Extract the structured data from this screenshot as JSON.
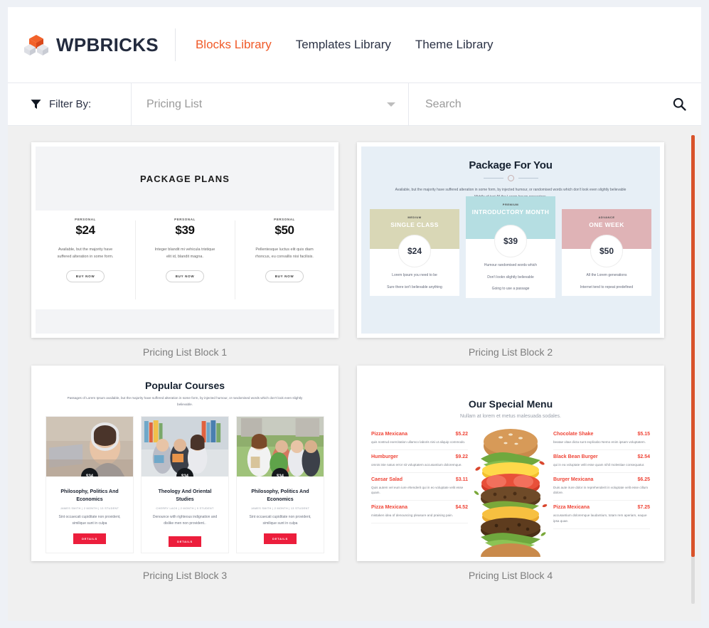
{
  "header": {
    "brand_name": "WPBRICKS",
    "logo_icon": "isometric-blocks-icon",
    "nav": [
      {
        "label": "Blocks Library",
        "active": true
      },
      {
        "label": "Templates Library",
        "active": false
      },
      {
        "label": "Theme Library",
        "active": false
      }
    ],
    "accent_color": "#f05a28"
  },
  "filterbar": {
    "funnel_icon": "funnel-icon",
    "filter_label": "Filter By:",
    "category_value": "Pricing List",
    "caret_icon": "chevron-down-icon",
    "search_value": "",
    "search_placeholder": "Search",
    "search_icon": "search-icon"
  },
  "scrollbar": {
    "thumb_color": "#d9532a",
    "track_color": "#dcdcdc"
  },
  "blocks": [
    {
      "caption": "Pricing List Block 1",
      "preview": {
        "title": "PACKAGE PLANS",
        "plans": [
          {
            "tier": "PERSONAL",
            "price": "$24",
            "desc": "Available, but the majority have suffered alteration in some form.",
            "button": "BUY NOW"
          },
          {
            "tier": "PERSONAL",
            "price": "$39",
            "desc": "Integer blandit mi vehicula tristique elit id, blandit magna.",
            "button": "BUY NOW"
          },
          {
            "tier": "PERSONAL",
            "price": "$50",
            "desc": "Pellentesque luctus elit quis diam rhoncus, eu convallis nisi facilisis.",
            "button": "BUY NOW"
          }
        ]
      }
    },
    {
      "caption": "Pricing List Block 2",
      "preview": {
        "title": "Package For You",
        "subtitle": "Available, but the majority have suffered alteration in some form, by injected humour, or randomised words which don't look even slightly believable Middle of text All the Lorem Ipsum generators.",
        "plans": [
          {
            "tier": "MEDIUM",
            "name": "SINGLE CLASS",
            "price": "$24",
            "band_color": "#d9d7b6",
            "features": [
              "Lorem Ipsum you need to be",
              "Sure there isn't believable anything"
            ]
          },
          {
            "tier": "PREMIUM",
            "name": "INTRODUCTORY MONTH",
            "price": "$39",
            "band_color": "#b5dee2",
            "features": [
              "Humour randomised words which",
              "Don't lookn slightly believable",
              "Going to use a passage"
            ]
          },
          {
            "tier": "ADVANCE",
            "name": "ONE WEEK",
            "price": "$50",
            "band_color": "#dfb3b6",
            "features": [
              "All the Lorem generations",
              "Internet tend to repeat predefined"
            ]
          }
        ]
      }
    },
    {
      "caption": "Pricing List Block 3",
      "preview": {
        "title": "Popular Courses",
        "subtitle": "Passages of Lorem Ipsum available, but the majority have suffered alteration in some form, by injected humour, or randomised words which don't look even slightly believable.",
        "courses": [
          {
            "badge": "$34",
            "name": "Philosophy, Politics And Economics",
            "meta": "JAMES SMITH | 2 MONTH | 13 STUDENT",
            "desc": "Sint occaecati cupiditate non provident, similique sunt in culpa",
            "button": "DETAILS"
          },
          {
            "badge": "$34",
            "name": "Theology And Oriental Studies",
            "meta": "CHERRY LACK | 2 MONTH | 9 STUDENT",
            "desc": "Denounce with righteous indignation and dislike men non provident..",
            "button": "DETAILS"
          },
          {
            "badge": "$34",
            "name": "Philosophy, Politics And Economics",
            "meta": "JAMES SMITH | 2 MONTH | 13 STUDENT",
            "desc": "Sint occaecati cupiditate non provident, similique sunt in culpa",
            "button": "DETAILS"
          }
        ],
        "button_color": "#ec1e3c"
      }
    },
    {
      "caption": "Pricing List Block 4",
      "preview": {
        "title": "Our Special Menu",
        "subtitle": "Nullam at lorem et metus malesuada sodales.",
        "menu_left": [
          {
            "name": "Pizza Mexicana",
            "price": "$5.22",
            "desc": "quis nostrud exercitation ullamco laboris nisi ut aliquip commodo."
          },
          {
            "name": "Humburger",
            "price": "$9.22",
            "desc": "omnis iste natus error sit voluptatem accusantium doloremque."
          },
          {
            "name": "Caesar Salad",
            "price": "$3.11",
            "desc": "Quis autem vel eum iure ehenderit qui in eo voluptate velit esse quam."
          },
          {
            "name": "Pizza Mexicana",
            "price": "$4.52",
            "desc": "mistaken idea of denouncing pleasure and praising pain."
          }
        ],
        "menu_right": [
          {
            "name": "Chocolate Shake",
            "price": "$5.15",
            "desc": "beatae vitae dicta sunt explicabo Nemo enim ipsam voluptatem."
          },
          {
            "name": "Black Bean Burger",
            "price": "$2.54",
            "desc": "qui in ea voluptate velit esse quam nihil molestiae consequatur."
          },
          {
            "name": "Burger Mexicana",
            "price": "$6.25",
            "desc": "Duis aute irure dolor in reprehenderit in voluptate velit esse cillum dolore."
          },
          {
            "name": "Pizza Mexicana",
            "price": "$7.25",
            "desc": "accusantium doloremque laudantium, totam rem aperiam, eaque ipsa quae."
          }
        ],
        "image": "burger-image",
        "accent_color": "#ef4436"
      }
    }
  ]
}
